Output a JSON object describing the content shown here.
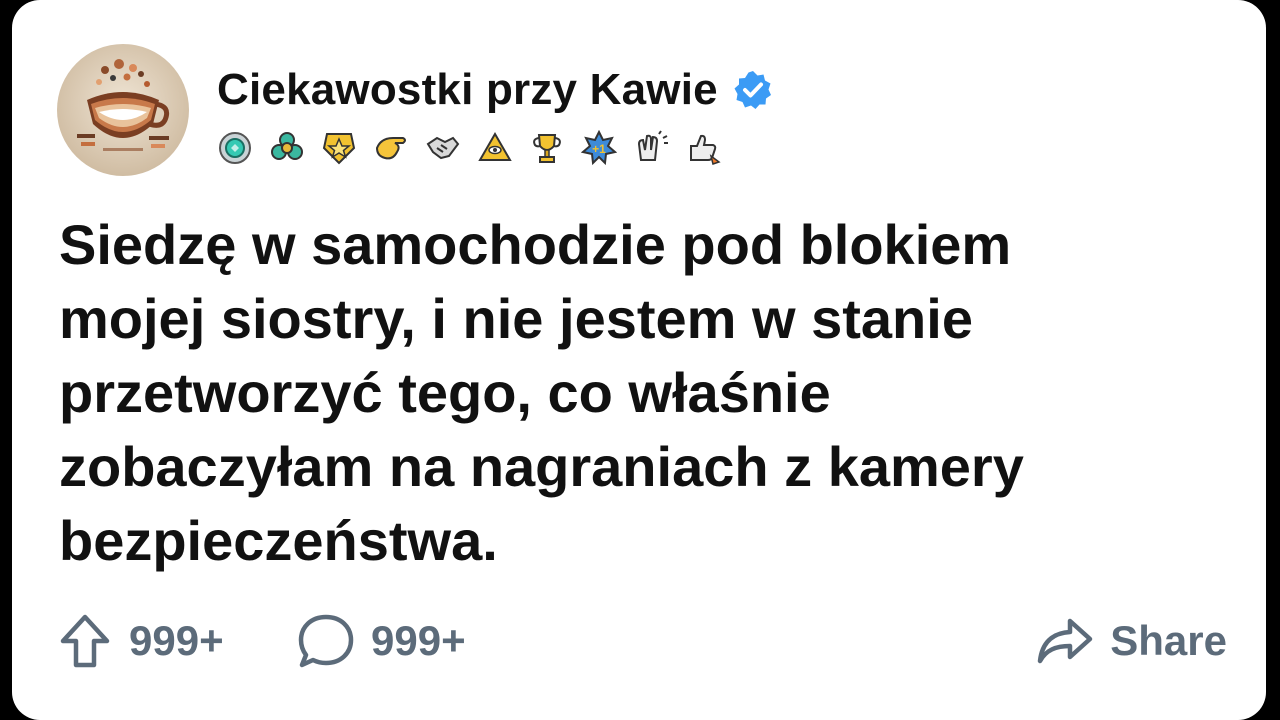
{
  "author": {
    "name": "Ciekawostki przy Kawie",
    "verified": true,
    "avatar_icon": "coffee-cup-art-icon",
    "badges": [
      "gem-medal-icon",
      "clover-gem-icon",
      "star-medal-icon",
      "hand-point-icon",
      "handshake-icon",
      "pyramid-eye-icon",
      "trophy-icon",
      "plus-one-badge-icon",
      "clapping-hands-icon",
      "thumbs-up-rocket-icon"
    ]
  },
  "post": {
    "text": "Siedzę w samochodzie pod blokiem\nmojej siostry, i  nie jestem w stanie\nprzetworzyć tego, co właśnie\nzobaczyłam na nagraniach z kamery\nbezpieczeństwa."
  },
  "actions": {
    "upvote_count": "999+",
    "comment_count": "999+",
    "share_label": "Share"
  },
  "colors": {
    "text": "#111111",
    "muted": "#5c6b7a",
    "verified": "#3b9bf5",
    "background": "#ffffff"
  }
}
